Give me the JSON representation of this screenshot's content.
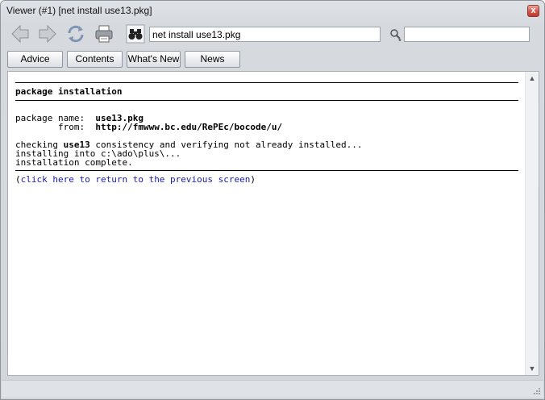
{
  "window": {
    "title": "Viewer (#1) [net install use13.pkg]",
    "close_label": "x"
  },
  "toolbar": {
    "back_icon": "back-arrow-icon",
    "forward_icon": "forward-arrow-icon",
    "refresh_icon": "refresh-icon",
    "print_icon": "printer-icon",
    "find_icon": "binoculars-icon",
    "command_value": "net install use13.pkg",
    "search_value": ""
  },
  "navbar": {
    "advice": "Advice",
    "contents": "Contents",
    "whats_new": "What's New",
    "news": "News"
  },
  "doc": {
    "heading": "package installation",
    "name_label": "package name:  ",
    "name_value": "use13.pkg",
    "from_label": "        from:  ",
    "from_value": "http://fmwww.bc.edu/RePEc/bocode/u/",
    "check_prefix": "checking ",
    "check_pkg": "use13",
    "check_suffix": " consistency and verifying not already installed...",
    "installing": "installing into c:\\ado\\plus\\...",
    "complete": "installation complete.",
    "return_open": "(",
    "return_link": "click here to return to the previous screen",
    "return_close": ")"
  },
  "colors": {
    "link": "#1a1aa6",
    "chrome": "#d6dade"
  }
}
